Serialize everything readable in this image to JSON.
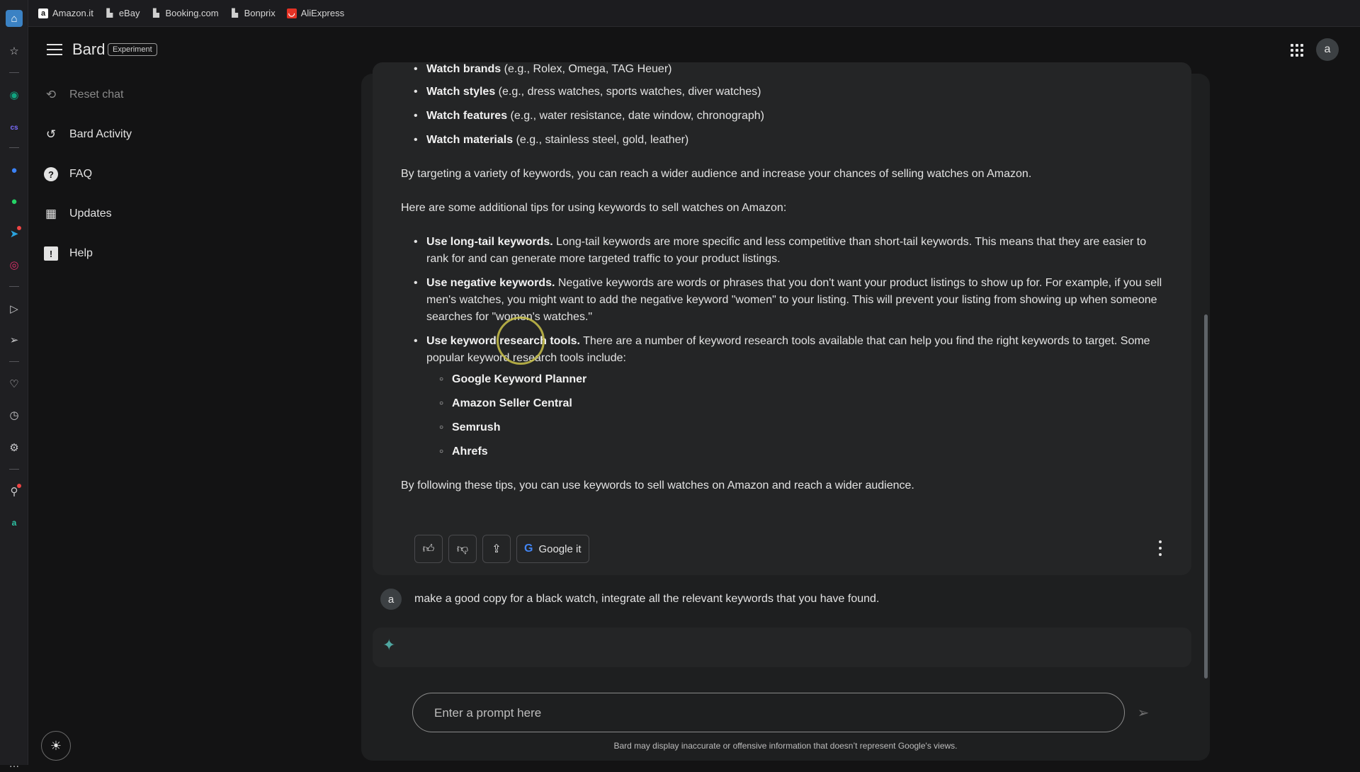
{
  "bookmarks": [
    {
      "label": "Amazon.it",
      "icon": "amazon-icon"
    },
    {
      "label": "eBay",
      "icon": "page-icon"
    },
    {
      "label": "Booking.com",
      "icon": "page-icon"
    },
    {
      "label": "Bonprix",
      "icon": "page-icon"
    },
    {
      "label": "AliExpress",
      "icon": "aliexpress-icon"
    }
  ],
  "header": {
    "brand": "Bard",
    "badge": "Experiment",
    "avatar_letter": "a"
  },
  "sidebar": {
    "items": [
      {
        "label": "Reset chat",
        "icon": "reset-icon"
      },
      {
        "label": "Bard Activity",
        "icon": "history-icon"
      },
      {
        "label": "FAQ",
        "icon": "help-circle-icon"
      },
      {
        "label": "Updates",
        "icon": "calendar-icon"
      },
      {
        "label": "Help",
        "icon": "feedback-icon"
      }
    ]
  },
  "response": {
    "watch_list": [
      {
        "bold": "Watch brands",
        "rest": " (e.g., Rolex, Omega, TAG Heuer)"
      },
      {
        "bold": "Watch styles",
        "rest": " (e.g., dress watches, sports watches, diver watches)"
      },
      {
        "bold": "Watch features",
        "rest": " (e.g., water resistance, date window, chronograph)"
      },
      {
        "bold": "Watch materials",
        "rest": " (e.g., stainless steel, gold, leather)"
      }
    ],
    "para1": "By targeting a variety of keywords, you can reach a wider audience and increase your chances of selling watches on Amazon.",
    "para2": "Here are some additional tips for using keywords to sell watches on Amazon:",
    "tips": [
      {
        "bold": "Use long-tail keywords.",
        "rest": " Long-tail keywords are more specific and less competitive than short-tail keywords. This means that they are easier to rank for and can generate more targeted traffic to your product listings."
      },
      {
        "bold": "Use negative keywords.",
        "rest": " Negative keywords are words or phrases that you don't want your product listings to show up for. For example, if you sell men's watches, you might want to add the negative keyword \"women\" to your listing. This will prevent your listing from showing up when someone searches for \"women's watches.\""
      },
      {
        "bold": "Use keyword research tools.",
        "rest": " There are a number of keyword research tools available that can help you find the right keywords to target. Some popular keyword research tools include:"
      }
    ],
    "tools": [
      "Google Keyword Planner",
      "Amazon Seller Central",
      "Semrush",
      "Ahrefs"
    ],
    "para3": "By following these tips, you can use keywords to sell watches on Amazon and reach a wider audience.",
    "google_it_label": "Google it"
  },
  "user_prompt": {
    "avatar_letter": "a",
    "text": "make a good copy for a black watch, integrate all the relevant keywords that you have found."
  },
  "input": {
    "placeholder": "Enter a prompt here"
  },
  "disclaimer": "Bard may display inaccurate or offensive information that doesn’t represent Google's views.",
  "colors": {
    "background": "#131314",
    "panel": "#1e1f20",
    "card": "#242526",
    "text": "#e3e3e3"
  }
}
